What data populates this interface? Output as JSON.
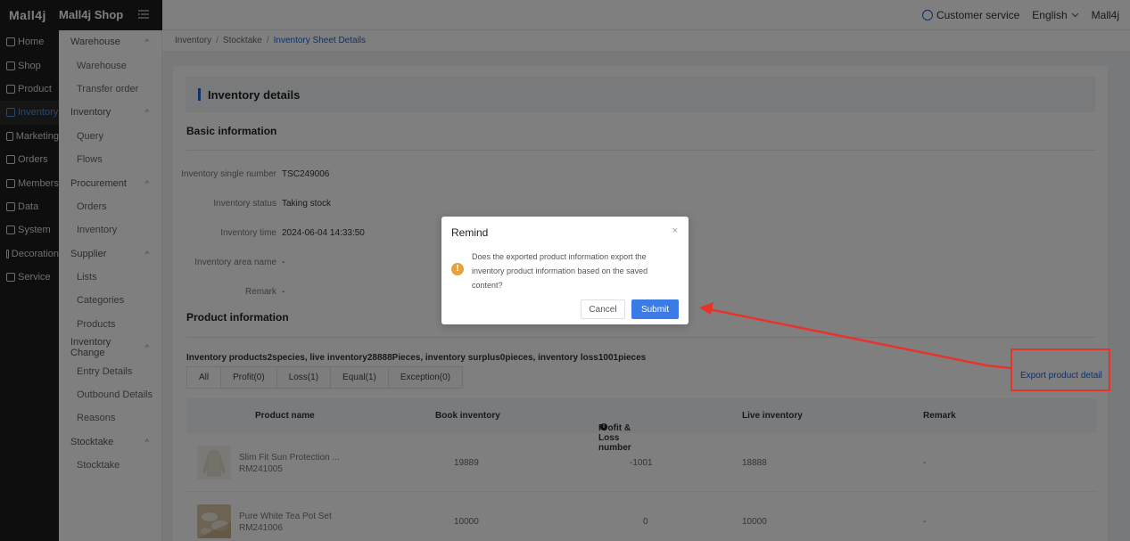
{
  "topbar": {
    "logo": "Mall4j",
    "shop_name": "Mall4j Shop",
    "customer_service": "Customer service",
    "language": "English",
    "user": "Mall4j"
  },
  "nav_primary": [
    {
      "label": "Home",
      "icon": "home-icon",
      "active": false
    },
    {
      "label": "Shop",
      "icon": "shop-icon",
      "active": false
    },
    {
      "label": "Product",
      "icon": "product-icon",
      "active": false
    },
    {
      "label": "Inventory",
      "icon": "inventory-icon",
      "active": true
    },
    {
      "label": "Marketing",
      "icon": "gift-icon",
      "active": false
    },
    {
      "label": "Orders",
      "icon": "orders-icon",
      "active": false
    },
    {
      "label": "Members",
      "icon": "members-icon",
      "active": false
    },
    {
      "label": "Data",
      "icon": "data-icon",
      "active": false
    },
    {
      "label": "System",
      "icon": "gear-icon",
      "active": false
    },
    {
      "label": "Decoration",
      "icon": "decoration-icon",
      "active": false
    },
    {
      "label": "Service",
      "icon": "chat-icon",
      "active": false
    }
  ],
  "nav_secondary": {
    "warehouse": "Warehouse",
    "warehouse_items": [
      "Warehouse",
      "Transfer order"
    ],
    "inventory": "Inventory",
    "inventory_items": [
      "Query",
      "Flows"
    ],
    "procurement": "Procurement",
    "procurement_items": [
      "Orders",
      "Inventory"
    ],
    "supplier": "Supplier",
    "supplier_items": [
      "Lists",
      "Categories",
      "Products"
    ],
    "inventory_change": "Inventory Change",
    "inventory_change_items": [
      "Entry Details",
      "Outbound Details",
      "Reasons"
    ],
    "stocktake": "Stocktake",
    "stocktake_items": [
      "Stocktake"
    ]
  },
  "breadcrumb": {
    "l1": "Inventory",
    "l2": "Stocktake",
    "current": "Inventory Sheet Details",
    "sep": "/"
  },
  "page": {
    "title": "Inventory details",
    "basic_info": "Basic information",
    "fields": [
      {
        "label": "Inventory single number",
        "value": "TSC249006"
      },
      {
        "label": "Inventory status",
        "value": "Taking stock"
      },
      {
        "label": "Inventory time",
        "value": "2024-06-04 14:33:50"
      },
      {
        "label": "Inventory area name",
        "value": "-"
      },
      {
        "label": "Remark",
        "value": "-"
      }
    ],
    "product_info": "Product information",
    "summary": "Inventory products2species, live inventory28888Pieces, inventory surplus0pieces, inventory loss1001pieces",
    "tabs": [
      "All",
      "Profit(0)",
      "Loss(1)",
      "Equal(1)",
      "Exception(0)"
    ],
    "export_link": "Export product detail"
  },
  "table": {
    "columns": [
      "Product name",
      "Book inventory",
      "Profit & Loss number",
      "Live inventory",
      "Remark"
    ],
    "rows": [
      {
        "name": "Slim Fit Sun Protection ...",
        "code": "RM241005",
        "book": "19889",
        "pl": "-1001",
        "live": "18888",
        "remark": "-"
      },
      {
        "name": "Pure White Tea Pot Set",
        "code": "RM241006",
        "book": "10000",
        "pl": "0",
        "live": "10000",
        "remark": "-"
      }
    ]
  },
  "dialog": {
    "title": "Remind",
    "message": "Does the exported product information export the inventory product information based on the saved content?",
    "cancel": "Cancel",
    "submit": "Submit",
    "close": "×",
    "warn_glyph": "!"
  },
  "colors": {
    "accent": "#1d61d6",
    "submit": "#3b7be8",
    "warning": "#e6a23c",
    "annotation": "#e8332b"
  }
}
